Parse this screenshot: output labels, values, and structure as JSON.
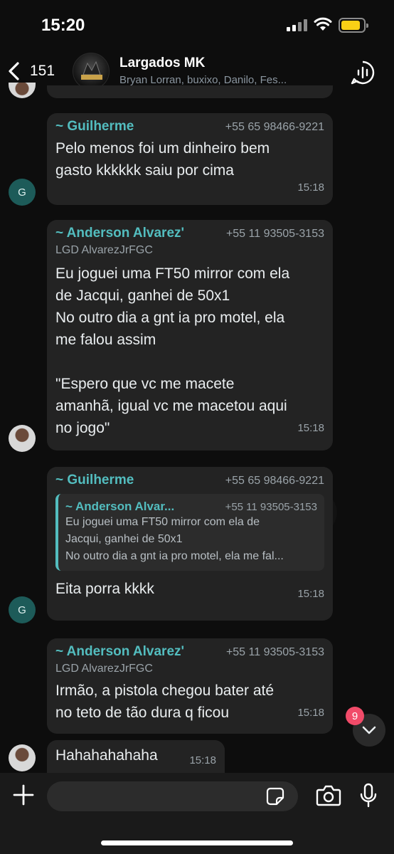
{
  "status_bar": {
    "time": "15:20"
  },
  "header": {
    "back_count": "151",
    "group_name": "Largados MK",
    "members": "Bryan Lorran, buxixo, Danilo, Fes..."
  },
  "messages": [
    {
      "sender": "~ Guilherme",
      "phone": "+55 65 98466-9221",
      "text_lines": [
        "Pelo menos foi um dinheiro bem",
        "gasto kkkkkk saiu por cima"
      ],
      "time": "15:18",
      "avatar_letter": "G"
    },
    {
      "sender": "~ Anderson Alvarez'",
      "phone": "+55 11 93505-3153",
      "alias": "LGD AlvarezJrFGC",
      "text_lines": [
        "Eu joguei uma FT50 mirror com ela",
        "de Jacqui, ganhei de 50x1",
        "No outro dia a gnt ia pro motel, ela",
        "me falou assim",
        "",
        "\"Espero que vc me macete",
        "amanhã, igual vc me macetou aqui",
        "no jogo\""
      ],
      "time": "15:18"
    },
    {
      "sender": "~ Guilherme",
      "phone": "+55 65 98466-9221",
      "quote": {
        "sender": "~ Anderson Alvar...",
        "phone": "+55 11 93505-3153",
        "lines": [
          "Eu joguei uma FT50 mirror com ela de",
          "Jacqui, ganhei de 50x1",
          "No outro dia a gnt ia pro motel, ela me fal..."
        ]
      },
      "text": "Eita porra kkkk",
      "time": "15:18",
      "avatar_letter": "G"
    },
    {
      "sender": "~ Anderson Alvarez'",
      "phone": "+55 11 93505-3153",
      "alias": "LGD AlvarezJrFGC",
      "text_lines": [
        "Irmão, a pistola chegou bater até",
        "no teto de tão dura q ficou"
      ],
      "time": "15:18"
    },
    {
      "text": "Hahahahahaha",
      "time": "15:18"
    }
  ],
  "unread_count": "9",
  "composer": {
    "placeholder": ""
  },
  "colors": {
    "accent": "#53bdbf",
    "bubble": "#232323",
    "badge": "#f14b69",
    "battery": "#f9d016"
  }
}
